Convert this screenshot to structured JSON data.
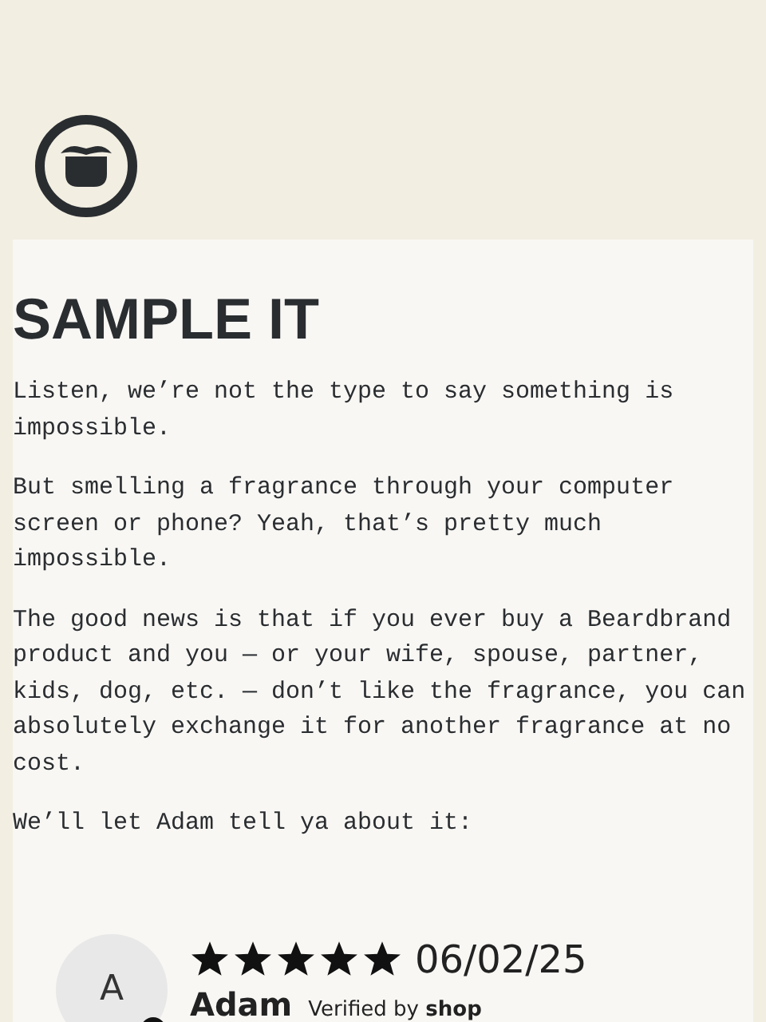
{
  "heading": "SAMPLE IT",
  "paragraphs": [
    "Listen, we’re not the type to say something is impossible.",
    "But smelling a fragrance through your computer screen or phone? Yeah, that’s pretty much impossible.",
    "The good news is that if you ever buy a Beardbrand product and you — or your wife, spouse, partner, kids, dog, etc. — don’t like the fragrance, you can absolutely exchange it for another fragrance at no cost.",
    "We’ll let Adam tell ya about it:"
  ],
  "review": {
    "initial": "A",
    "stars": 5,
    "date": "06/02/25",
    "name": "Adam",
    "verified": "Verified by **shop**"
  }
}
